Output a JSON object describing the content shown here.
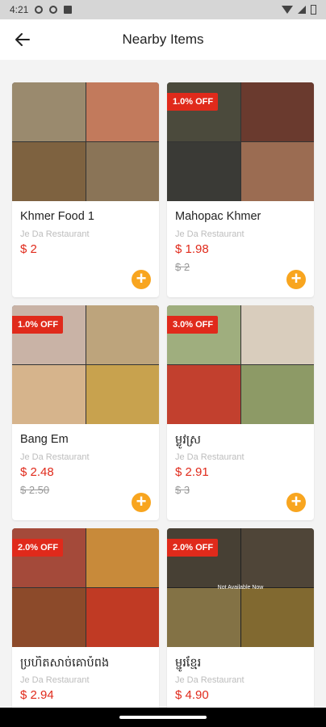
{
  "status": {
    "time": "4:21"
  },
  "header": {
    "title": "Nearby Items",
    "back_icon": "arrow-left-icon"
  },
  "colors": {
    "accent": "#e02a1b",
    "add_button": "#f8a51f"
  },
  "items": [
    {
      "name": "Khmer Food 1",
      "store": "Je Da Restaurant",
      "price": "$ 2",
      "old_price": "",
      "discount": "",
      "available": true,
      "add": "+",
      "tiles": [
        "#9a8a6e",
        "#c27a5c",
        "#7e6240",
        "#8a7457"
      ]
    },
    {
      "name": "Mahopac Khmer",
      "store": "Je Da Restaurant",
      "price": "$ 1.98",
      "old_price": "$ 2",
      "discount": "1.0% OFF",
      "available": true,
      "add": "+",
      "tiles": [
        "#4b4a3c",
        "#6a3a2e",
        "#3a3a36",
        "#9b6c52"
      ]
    },
    {
      "name": "Bang Em",
      "store": "Je Da Restaurant",
      "price": "$ 2.48",
      "old_price": "$ 2.50",
      "discount": "1.0% OFF",
      "available": true,
      "add": "+",
      "tiles": [
        "#c9b3a6",
        "#bda47c",
        "#d6b48c",
        "#c8a24e"
      ]
    },
    {
      "name": "ម្លូវស្រ",
      "store": "Je Da Restaurant",
      "price": "$ 2.91",
      "old_price": "$ 3",
      "discount": "3.0% OFF",
      "available": true,
      "add": "+",
      "tiles": [
        "#9fae7e",
        "#d9cdbd",
        "#c2402e",
        "#8d9a66"
      ]
    },
    {
      "name": "ប្រហិតសាច់គោបំពង",
      "store": "Je Da Restaurant",
      "price": "$ 2.94",
      "old_price": "",
      "discount": "2.0% OFF",
      "available": true,
      "add": "+",
      "tiles": [
        "#a44a3a",
        "#c88a3a",
        "#8c4a2a",
        "#c03a24"
      ]
    },
    {
      "name": "ម្ជូរខ្មែរ",
      "store": "Je Da Restaurant",
      "price": "$ 4.90",
      "old_price": "",
      "discount": "2.0% OFF",
      "available": false,
      "na_label": "Not Available Now",
      "add": "",
      "tiles": [
        "#6e6350",
        "#7a6b57",
        "#c9b06a",
        "#c7a24a"
      ]
    }
  ]
}
